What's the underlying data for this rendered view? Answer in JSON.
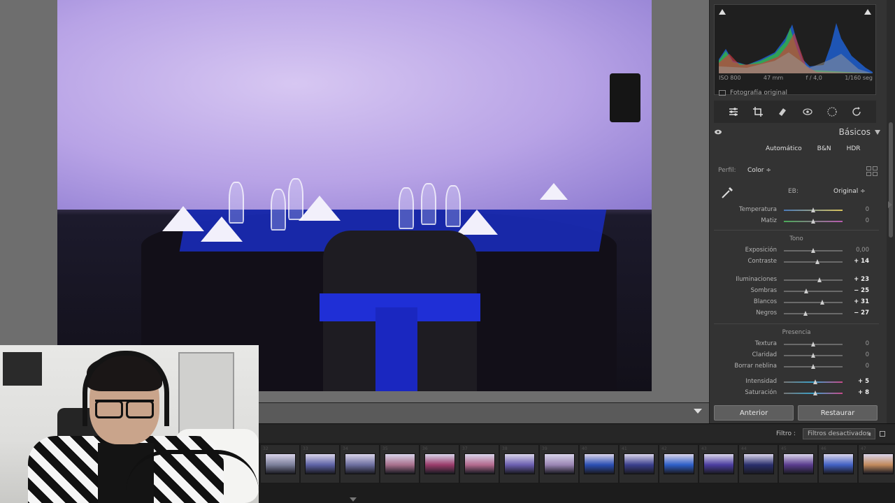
{
  "histogram": {
    "exif": [
      "ISO 800",
      "47 mm",
      "f / 4,0",
      "1/160 seg"
    ],
    "original_label": "Fotografía original"
  },
  "tools": [
    "sliders-icon",
    "crop-icon",
    "eraser-icon",
    "redeye-icon",
    "mask-icon",
    "reset-icon"
  ],
  "panel": {
    "section_title": "Básicos",
    "modes": [
      "Automático",
      "B&N",
      "HDR"
    ],
    "profile_label": "Perfil:",
    "profile_value": "Color ÷",
    "wb_label": "EB:",
    "wb_value": "Original ÷",
    "wb_sliders": [
      {
        "label": "Temperatura",
        "value": "0",
        "pos": 0.5,
        "changed": false
      },
      {
        "label": "Matiz",
        "value": "0",
        "pos": 0.5,
        "changed": false
      }
    ],
    "tone_title": "Tono",
    "tone_sliders": [
      {
        "label": "Exposición",
        "value": "0,00",
        "pos": 0.5,
        "changed": false
      },
      {
        "label": "Contraste",
        "value": "+ 14",
        "pos": 0.57,
        "changed": true
      },
      {
        "label": "Iluminaciones",
        "value": "+ 23",
        "pos": 0.61,
        "changed": true
      },
      {
        "label": "Sombras",
        "value": "− 25",
        "pos": 0.38,
        "changed": true
      },
      {
        "label": "Blancos",
        "value": "+ 31",
        "pos": 0.65,
        "changed": true
      },
      {
        "label": "Negros",
        "value": "− 27",
        "pos": 0.37,
        "changed": true
      }
    ],
    "presence_title": "Presencia",
    "presence_sliders": [
      {
        "label": "Textura",
        "value": "0",
        "pos": 0.5,
        "changed": false
      },
      {
        "label": "Claridad",
        "value": "0",
        "pos": 0.5,
        "changed": false
      },
      {
        "label": "Borrar neblina",
        "value": "0",
        "pos": 0.5,
        "changed": false
      },
      {
        "label": "Intensidad",
        "value": "+ 5",
        "pos": 0.53,
        "changed": true
      },
      {
        "label": "Saturación",
        "value": "+ 8",
        "pos": 0.54,
        "changed": true
      }
    ],
    "btn_previous": "Anterior",
    "btn_reset": "Restaurar"
  },
  "filmstrip": {
    "filter_label": "Filtro :",
    "filter_value": "Filtros desactivados",
    "thumbs": [
      {
        "num": "32",
        "color": "#7b7f9a"
      },
      {
        "num": "33",
        "color": "#5e63a6"
      },
      {
        "num": "34",
        "color": "#6d6fa0"
      },
      {
        "num": "35",
        "color": "#a8708c"
      },
      {
        "num": "36",
        "color": "#9a3c6a"
      },
      {
        "num": "37",
        "color": "#b36a8e"
      },
      {
        "num": "38",
        "color": "#6b5fb0"
      },
      {
        "num": "39",
        "color": "#9a86b4"
      },
      {
        "num": "40",
        "color": "#2b4fb3"
      },
      {
        "num": "41",
        "color": "#3a3f8c"
      },
      {
        "num": "42",
        "color": "#2e5fc8"
      },
      {
        "num": "43",
        "color": "#4b3da0"
      },
      {
        "num": "44",
        "color": "#2a2f6c"
      },
      {
        "num": "45",
        "color": "#5a3c8e"
      },
      {
        "num": "46",
        "color": "#4261c4"
      },
      {
        "num": "47",
        "color": "#c28a5c"
      }
    ]
  }
}
